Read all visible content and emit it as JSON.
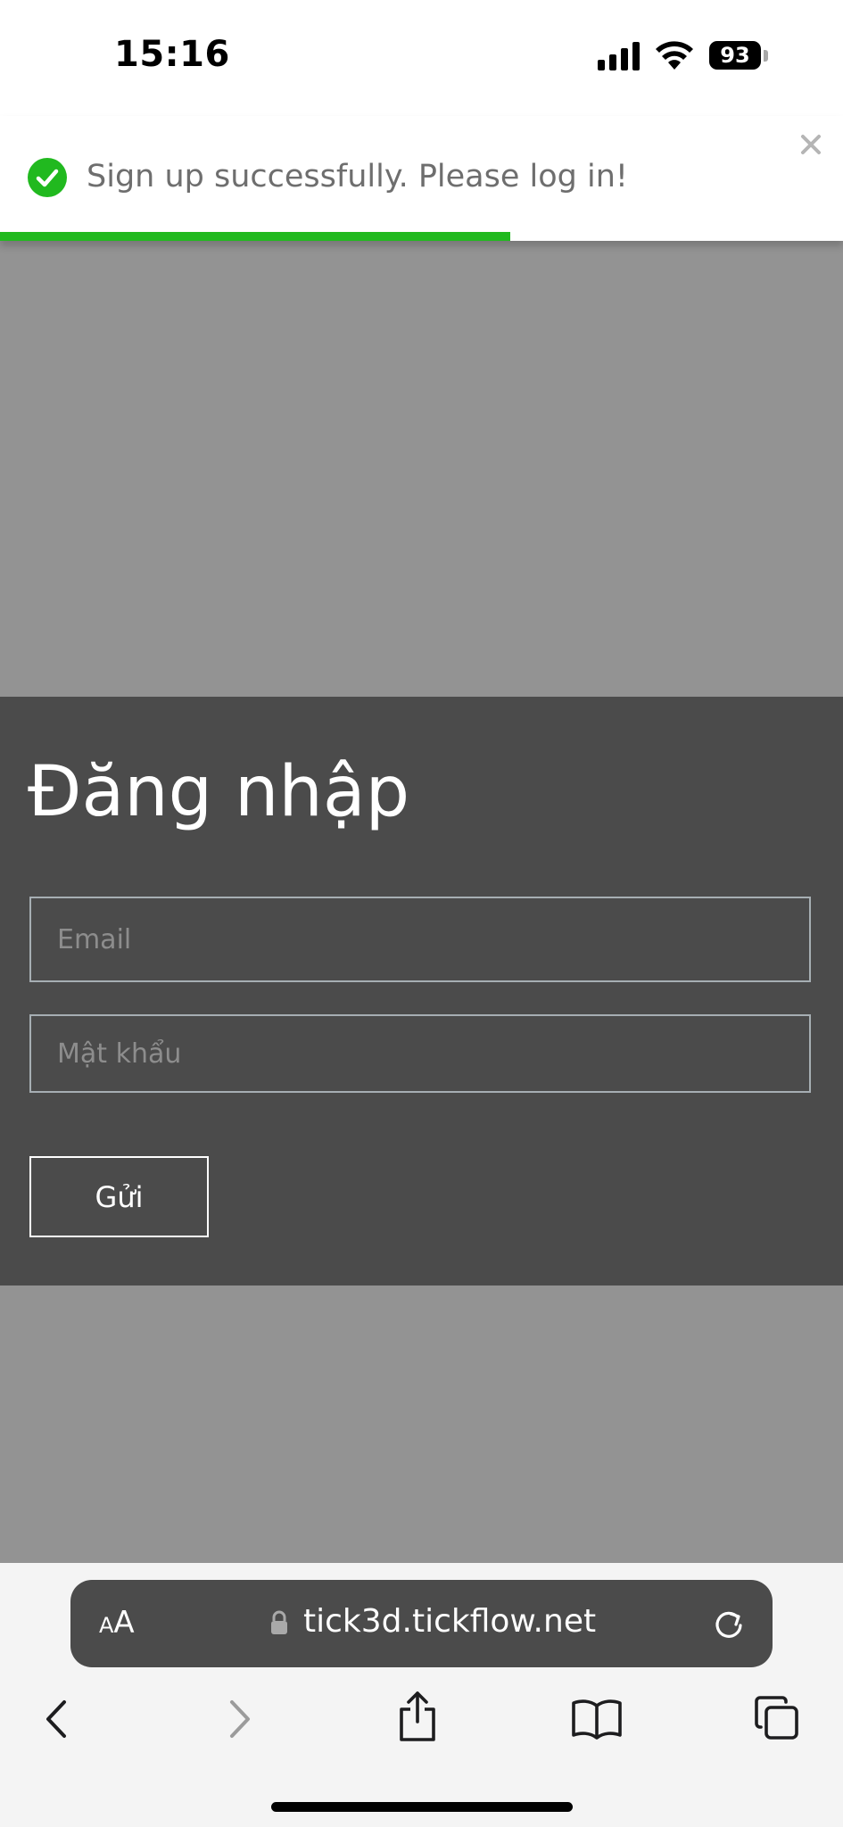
{
  "status_bar": {
    "time": "15:16",
    "battery": "93"
  },
  "toast": {
    "message": "Sign up successfully. Please log in!",
    "icon": "check-circle-icon",
    "close_icon": "close-icon",
    "progress_percent": 60.5,
    "accent_color": "#21b91f"
  },
  "login": {
    "title": "Đăng nhập",
    "email_placeholder": "Email",
    "password_placeholder": "Mật khẩu",
    "submit_label": "Gửi"
  },
  "browser": {
    "text_size_small": "A",
    "text_size_large": "A",
    "url": "tick3d.tickflow.net",
    "icons": [
      "lock-icon",
      "reload-icon",
      "back-icon",
      "forward-icon",
      "share-icon",
      "bookmarks-icon",
      "tabs-icon"
    ]
  },
  "colors": {
    "overlay": "#939393",
    "panel": "#4b4b4b",
    "address_bar": "#4b4b4b",
    "toolbar": "#f4f4f4"
  }
}
